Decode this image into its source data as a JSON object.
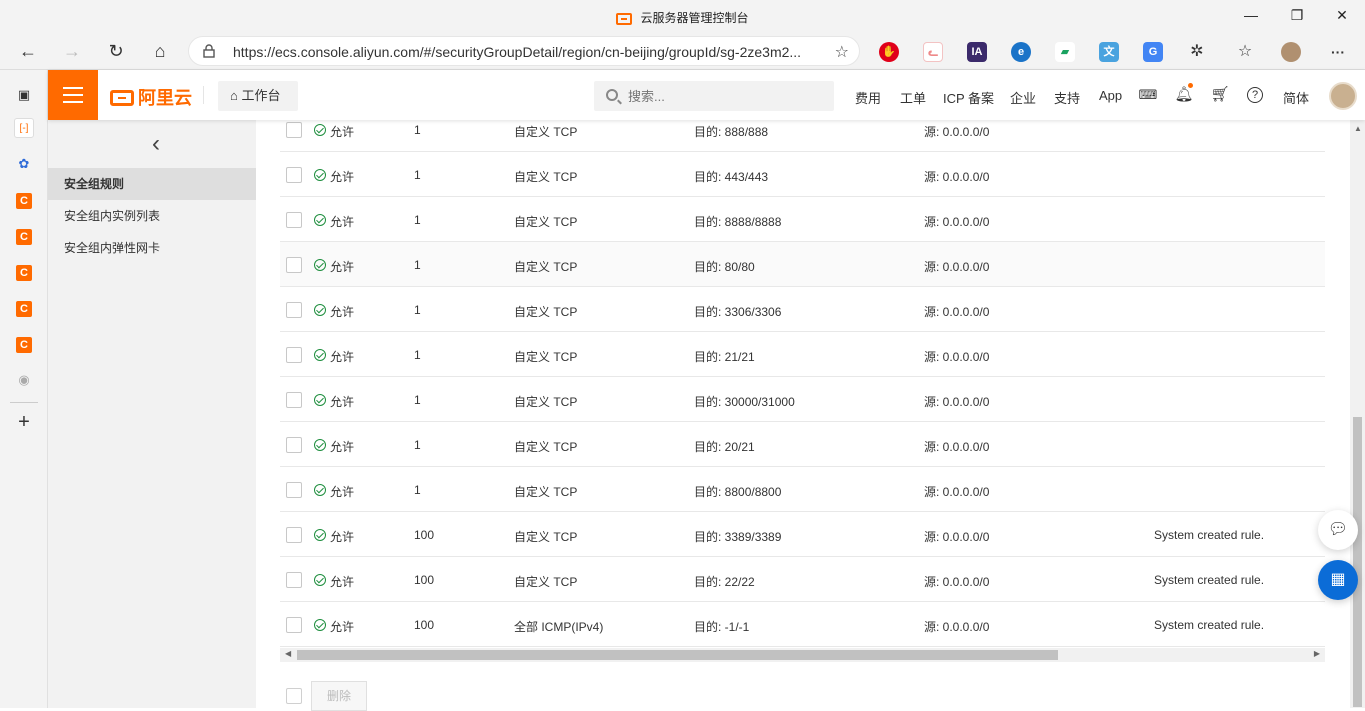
{
  "window": {
    "title": "云服务器管理控制台",
    "minimize": "—",
    "restore": "❐",
    "close": "✕"
  },
  "browser": {
    "url": "https://ecs.console.aliyun.com/#/securityGroupDetail/region/cn-beijing/groupId/sg-2ze3m2...",
    "back": "←",
    "forward": "→",
    "reload": "↻",
    "home": "⌂",
    "favorites": "☆",
    "more": "···"
  },
  "topbar": {
    "brand": "阿里云",
    "workbench": "工作台",
    "search_placeholder": "搜索...",
    "nav": [
      "费用",
      "工单",
      "ICP 备案",
      "企业",
      "支持",
      "App"
    ],
    "lang": "简体"
  },
  "sidebar": {
    "items": [
      {
        "label": "安全组规则",
        "active": true
      },
      {
        "label": "安全组内实例列表",
        "active": false
      },
      {
        "label": "安全组内弹性网卡",
        "active": false
      }
    ]
  },
  "rules": [
    {
      "policy": "允许",
      "priority": "1",
      "protocol": "自定义 TCP",
      "port": "目的: 888/888",
      "source": "源: 0.0.0.0/0",
      "desc": ""
    },
    {
      "policy": "允许",
      "priority": "1",
      "protocol": "自定义 TCP",
      "port": "目的: 443/443",
      "source": "源: 0.0.0.0/0",
      "desc": ""
    },
    {
      "policy": "允许",
      "priority": "1",
      "protocol": "自定义 TCP",
      "port": "目的: 8888/8888",
      "source": "源: 0.0.0.0/0",
      "desc": ""
    },
    {
      "policy": "允许",
      "priority": "1",
      "protocol": "自定义 TCP",
      "port": "目的: 80/80",
      "source": "源: 0.0.0.0/0",
      "desc": ""
    },
    {
      "policy": "允许",
      "priority": "1",
      "protocol": "自定义 TCP",
      "port": "目的: 3306/3306",
      "source": "源: 0.0.0.0/0",
      "desc": ""
    },
    {
      "policy": "允许",
      "priority": "1",
      "protocol": "自定义 TCP",
      "port": "目的: 21/21",
      "source": "源: 0.0.0.0/0",
      "desc": ""
    },
    {
      "policy": "允许",
      "priority": "1",
      "protocol": "自定义 TCP",
      "port": "目的: 30000/31000",
      "source": "源: 0.0.0.0/0",
      "desc": ""
    },
    {
      "policy": "允许",
      "priority": "1",
      "protocol": "自定义 TCP",
      "port": "目的: 20/21",
      "source": "源: 0.0.0.0/0",
      "desc": ""
    },
    {
      "policy": "允许",
      "priority": "1",
      "protocol": "自定义 TCP",
      "port": "目的: 8800/8800",
      "source": "源: 0.0.0.0/0",
      "desc": ""
    },
    {
      "policy": "允许",
      "priority": "100",
      "protocol": "自定义 TCP",
      "port": "目的: 3389/3389",
      "source": "源: 0.0.0.0/0",
      "desc": "System created rule."
    },
    {
      "policy": "允许",
      "priority": "100",
      "protocol": "自定义 TCP",
      "port": "目的: 22/22",
      "source": "源: 0.0.0.0/0",
      "desc": "System created rule."
    },
    {
      "policy": "允许",
      "priority": "100",
      "protocol": "全部 ICMP(IPv4)",
      "port": "目的: -1/-1",
      "source": "源: 0.0.0.0/0",
      "desc": "System created rule."
    }
  ],
  "footer": {
    "delete_label": "删除"
  },
  "colors": {
    "brand": "#ff6a00",
    "allow_green": "#1e8e3e",
    "float_blue": "#0b6cd7"
  }
}
